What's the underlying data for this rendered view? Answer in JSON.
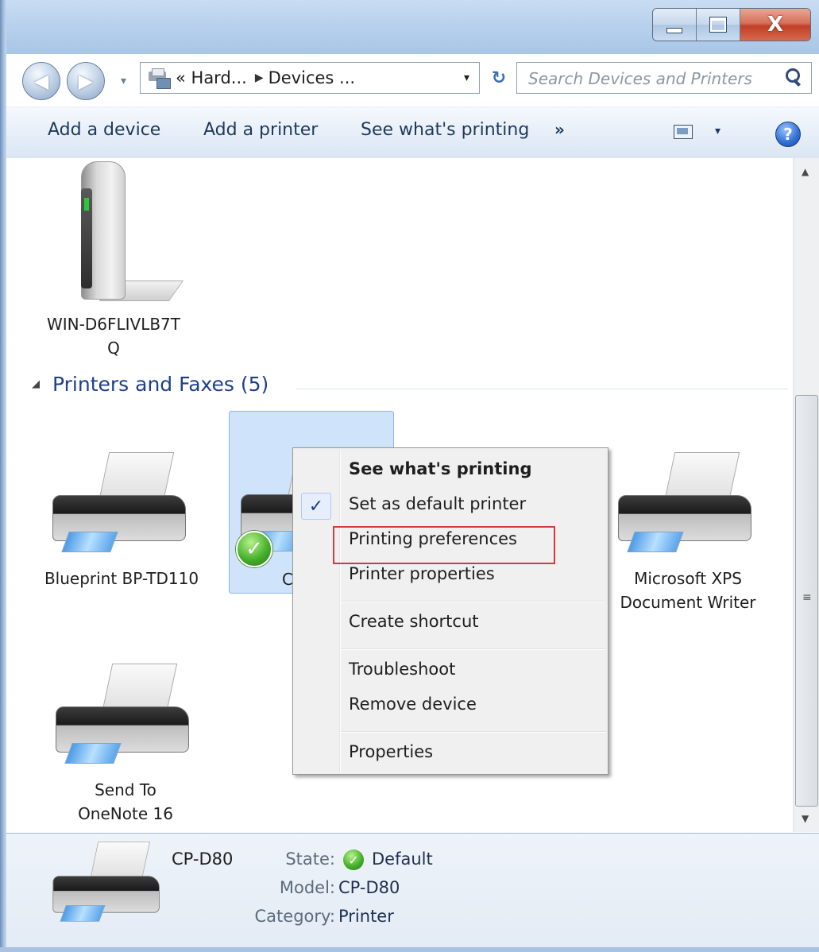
{
  "window": {
    "minimize_glyph": "—",
    "close_glyph": "X"
  },
  "nav": {
    "back_arrow": "◀",
    "forward_arrow": "▶",
    "recent_arrow": "▾",
    "address_crumbs": [
      "« Hard...",
      "Devices ..."
    ],
    "crumb_separator": "▶",
    "address_dropdown": "▾",
    "refresh_glyph": "↻",
    "search_placeholder": "Search Devices and Printers"
  },
  "commands": {
    "add_device": "Add a device",
    "add_printer": "Add a printer",
    "see_printing": "See what's printing",
    "more": "»",
    "view_dropdown": "▾",
    "help": "?"
  },
  "devices": {
    "server_label": "WIN-D6FLIVLB7T Q"
  },
  "printers_group": {
    "collapse_glyph": "◢",
    "title": "Printers and Faxes (5)",
    "items": [
      {
        "label": "Blueprint BP-TD110"
      },
      {
        "label": "C"
      },
      {
        "label": "Microsoft XPS Document Writer"
      },
      {
        "label": "Send To OneNote 16"
      }
    ]
  },
  "context_menu": {
    "check_glyph": "✓",
    "items": [
      {
        "label": "See what's printing",
        "bold": true
      },
      {
        "label": "Set as default printer",
        "checked": true
      },
      {
        "label": "Printing preferences",
        "highlighted": true
      },
      {
        "label": "Printer properties"
      },
      {
        "label": "Create shortcut"
      },
      {
        "label": "Troubleshoot"
      },
      {
        "label": "Remove device"
      },
      {
        "label": "Properties"
      }
    ]
  },
  "details": {
    "name": "CP-D80",
    "state_label": "State:",
    "state_value": "Default",
    "model_label": "Model:",
    "model_value": "CP-D80",
    "category_label": "Category:",
    "category_value": "Printer",
    "check_glyph": "✓"
  },
  "scrollbar": {
    "up": "▲",
    "down": "▼",
    "grip": "≡"
  },
  "colors": {
    "highlight_border": "#d43a3a",
    "selection_fill": "#cfe4fb",
    "group_title": "#1e3f8c"
  }
}
